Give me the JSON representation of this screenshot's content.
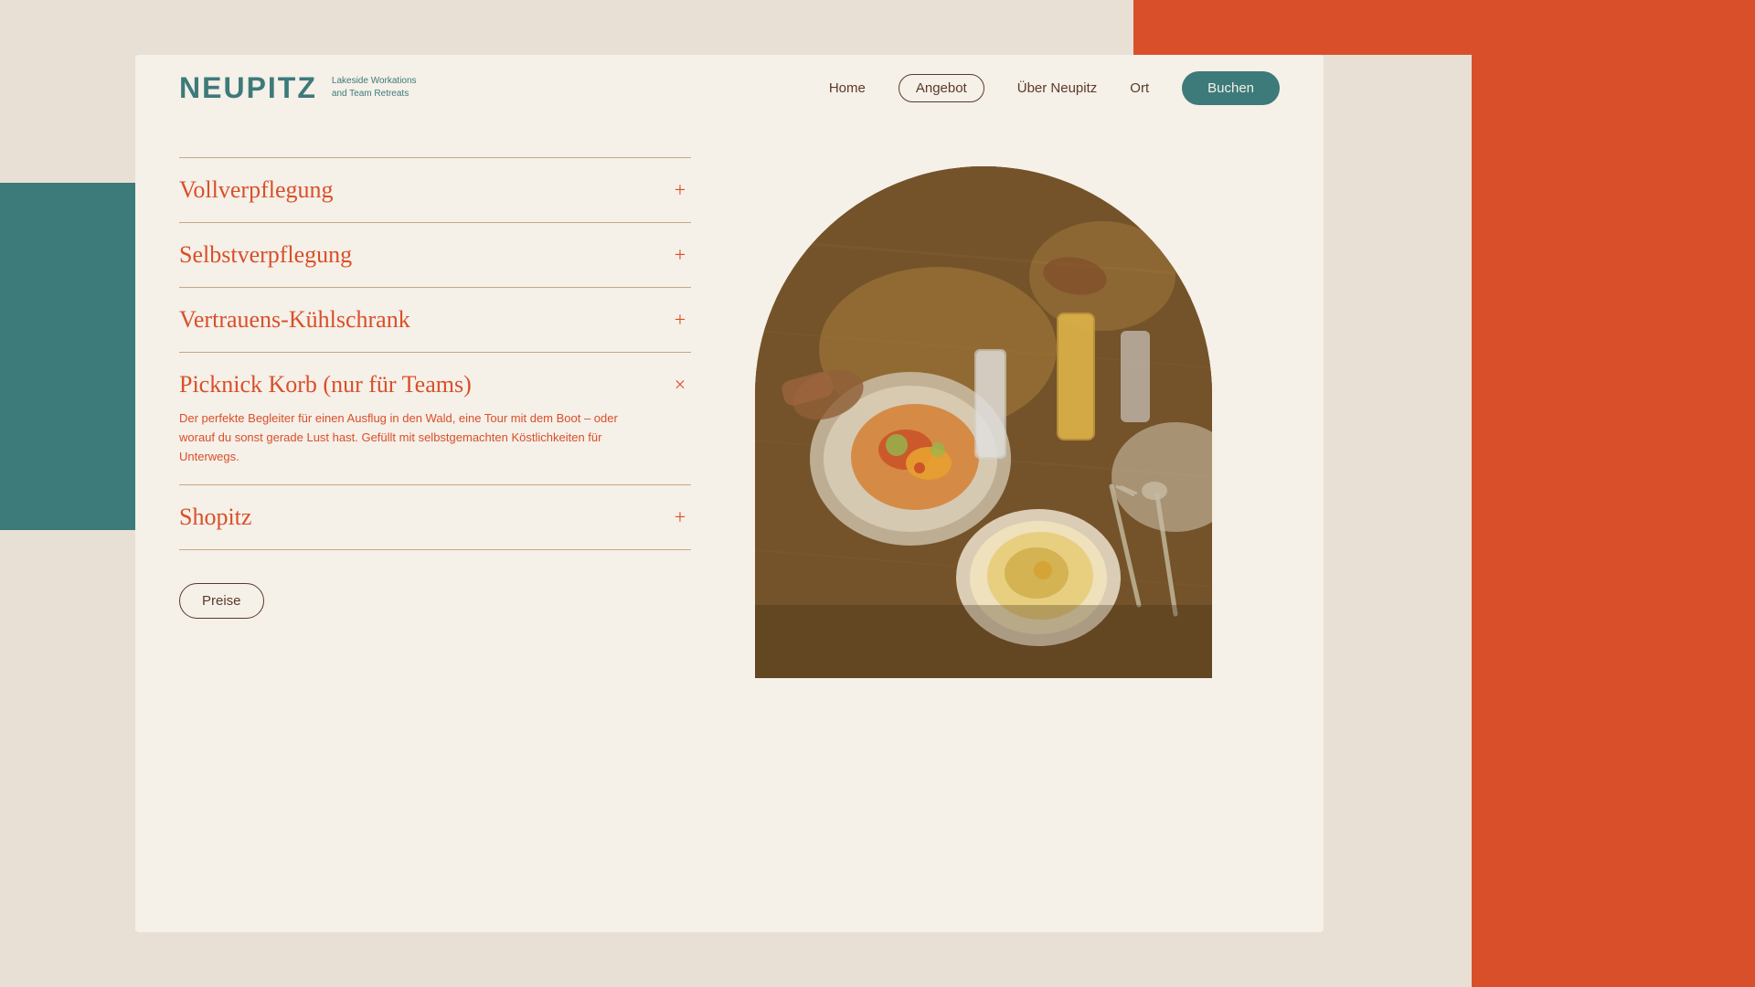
{
  "brand": {
    "name": "NEUPitZ",
    "tagline_line1": "Lakeside   Workations",
    "tagline_line2": "and    Team    Retreats"
  },
  "nav": {
    "home": "Home",
    "angebot": "Angebot",
    "uber_neupitz": "Über Neupitz",
    "ort": "Ort",
    "buchen": "Buchen"
  },
  "accordion": {
    "items": [
      {
        "id": "vollverpflegung",
        "title": "Vollverpflegung",
        "icon": "+",
        "expanded": false,
        "content": ""
      },
      {
        "id": "selbstverpflegung",
        "title": "Selbstverpflegung",
        "icon": "+",
        "expanded": false,
        "content": ""
      },
      {
        "id": "vertrauens-kuhlschrank",
        "title": "Vertrauens-Kühlschrank",
        "icon": "+",
        "expanded": false,
        "content": ""
      },
      {
        "id": "picknick-korb",
        "title": "Picknick Korb (nur für Teams)",
        "icon": "×",
        "expanded": true,
        "content": "Der perfekte Begleiter für einen Ausflug in den Wald, eine Tour mit dem Boot – oder worauf du sonst gerade Lust hast. Gefüllt mit selbstgemachten Köstlichkeiten für Unterwegs."
      },
      {
        "id": "shopitz",
        "title": "Shopitz",
        "icon": "+",
        "expanded": false,
        "content": ""
      }
    ]
  },
  "buttons": {
    "preise": "Preise"
  },
  "colors": {
    "orange": "#d94f2a",
    "teal": "#3d7a7a",
    "cream": "#f5f0e8",
    "brown": "#5a3a2a"
  }
}
